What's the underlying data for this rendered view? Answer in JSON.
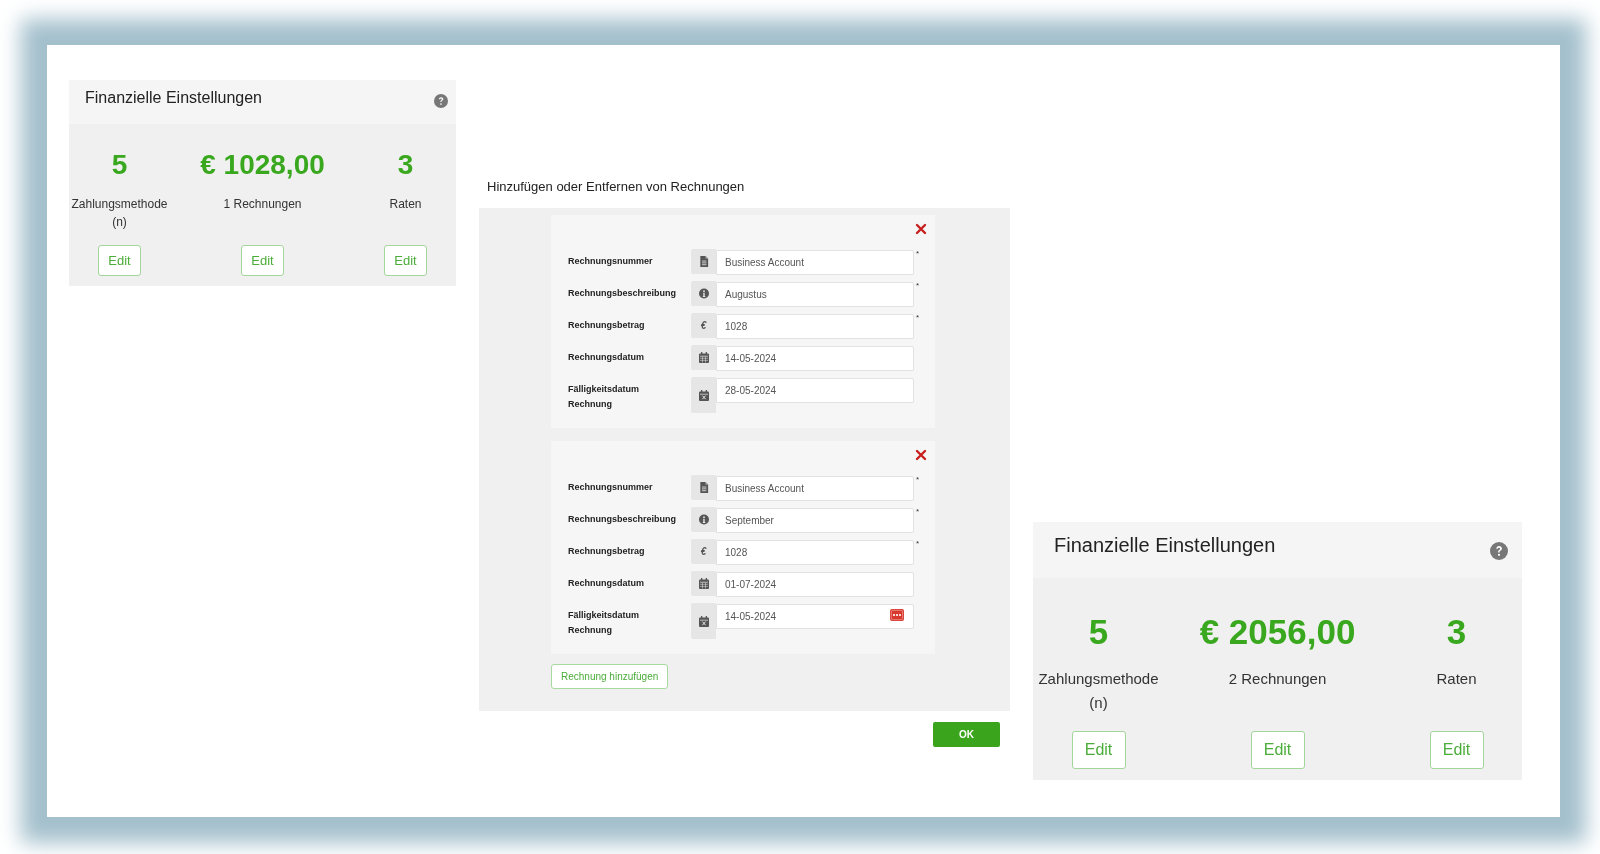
{
  "panels": [
    {
      "kind": "summary",
      "title": "Finanzielle Einstellungen",
      "stats": [
        {
          "value": "5",
          "label": "Zahlungsmethode (n)",
          "button": "Edit"
        },
        {
          "value": "€ 1028,00",
          "label": "1 Rechnungen",
          "button": "Edit"
        },
        {
          "value": "3",
          "label": "Raten",
          "button": "Edit"
        }
      ]
    },
    {
      "kind": "dialog",
      "title": "Hinzufügen oder Entfernen von Rechnungen",
      "invoices": [
        {
          "fields": [
            {
              "kind": "number",
              "label": "Rechnungsnummer",
              "value": "Business Account",
              "marker": "*"
            },
            {
              "kind": "description",
              "label": "Rechnungsbeschreibung",
              "value": "Augustus",
              "marker": "*"
            },
            {
              "kind": "amount",
              "label": "Rechnungsbetrag",
              "prefix": "€",
              "value": "1028",
              "marker": "*"
            },
            {
              "kind": "date",
              "label": "Rechnungsdatum",
              "value": "14-05-2024"
            },
            {
              "kind": "due_date",
              "label": "Fälligkeitsdatum Rechnung",
              "value": "28-05-2024",
              "picker_button": false
            }
          ]
        },
        {
          "fields": [
            {
              "kind": "number",
              "label": "Rechnungsnummer",
              "value": "Business Account",
              "marker": "*"
            },
            {
              "kind": "description",
              "label": "Rechnungsbeschreibung",
              "value": "September",
              "marker": "*"
            },
            {
              "kind": "amount",
              "label": "Rechnungsbetrag",
              "prefix": "€",
              "value": "1028",
              "marker": "*"
            },
            {
              "kind": "date",
              "label": "Rechnungsdatum",
              "value": "01-07-2024"
            },
            {
              "kind": "due_date",
              "label": "Fälligkeitsdatum Rechnung",
              "value": "14-05-2024",
              "picker_button": true
            }
          ]
        }
      ],
      "add_button": "Rechnung hinzufügen",
      "ok_button": "OK"
    },
    {
      "kind": "summary",
      "title": "Finanzielle Einstellungen",
      "stats": [
        {
          "value": "5",
          "label": "Zahlungsmethode (n)",
          "button": "Edit"
        },
        {
          "value": "€ 2056,00",
          "label": "2 Rechnungen",
          "button": "Edit"
        },
        {
          "value": "3",
          "label": "Raten",
          "button": "Edit"
        }
      ]
    }
  ]
}
